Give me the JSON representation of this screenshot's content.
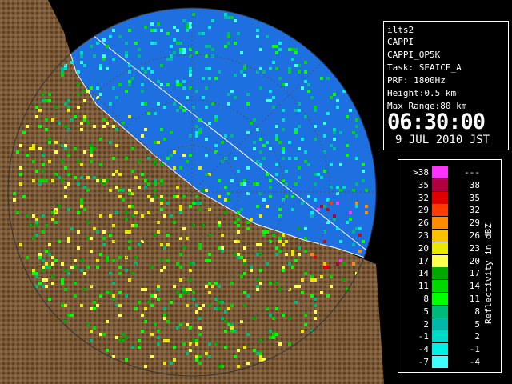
{
  "info": {
    "site": "ilts2",
    "product": "CAPPI",
    "product_name": "CAPPI_OP5K",
    "task": "Task: SEAICE_A",
    "prf": "PRF: 1800Hz",
    "height": "Height:0.5 km",
    "max_range": "Max Range:80 km",
    "time": "06:30:00",
    "date": "9 JUL 2010 JST"
  },
  "legend": {
    "unit": "Reflectivity in dBZ",
    "rows": [
      {
        "lo": ">38",
        "hi": "---",
        "color": "#ff33ff"
      },
      {
        "lo": "35",
        "hi": "38",
        "color": "#b00040"
      },
      {
        "lo": "32",
        "hi": "35",
        "color": "#e00000"
      },
      {
        "lo": "29",
        "hi": "32",
        "color": "#ff3c00"
      },
      {
        "lo": "26",
        "hi": "29",
        "color": "#ff8c00"
      },
      {
        "lo": "23",
        "hi": "26",
        "color": "#ffc000"
      },
      {
        "lo": "20",
        "hi": "23",
        "color": "#e8e800"
      },
      {
        "lo": "17",
        "hi": "20",
        "color": "#ffff50"
      },
      {
        "lo": "14",
        "hi": "17",
        "color": "#00a800"
      },
      {
        "lo": "11",
        "hi": "14",
        "color": "#00d800"
      },
      {
        "lo": "8",
        "hi": "11",
        "color": "#00ff00"
      },
      {
        "lo": "5",
        "hi": "8",
        "color": "#00b878"
      },
      {
        "lo": "2",
        "hi": "5",
        "color": "#00b8a8"
      },
      {
        "lo": "-1",
        "hi": "2",
        "color": "#00d8c8"
      },
      {
        "lo": "-4",
        "hi": "-1",
        "color": "#00f0e8"
      },
      {
        "lo": "-7",
        "hi": "-4",
        "color": "#40ffff"
      }
    ]
  },
  "map": {
    "ocean_color": "#1e6fe0",
    "land_color": "#7a5a3a",
    "background_color": "#000000"
  }
}
